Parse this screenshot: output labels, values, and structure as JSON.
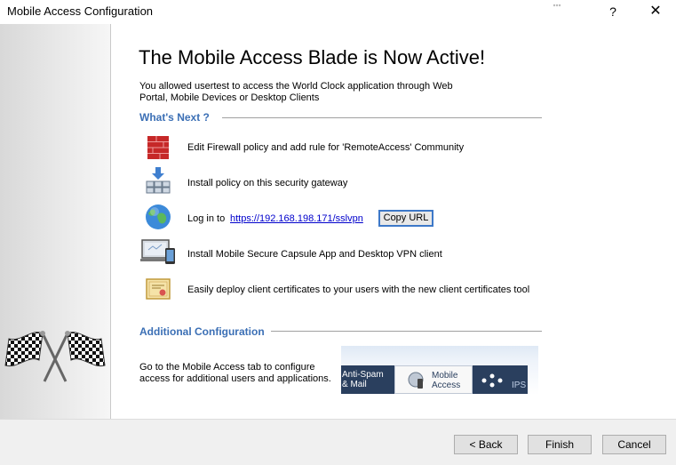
{
  "window": {
    "title": "Mobile Access Configuration",
    "help_label": "?",
    "close_label": "✕"
  },
  "main": {
    "heading": "The Mobile Access Blade is Now Active!",
    "intro": "You allowed usertest to access the World Clock application through Web Portal, Mobile Devices or Desktop Clients"
  },
  "whats_next": {
    "title": "What's Next ?",
    "items": [
      {
        "icon": "firewall-icon",
        "text": "Edit Firewall policy and add rule for 'RemoteAccess' Community"
      },
      {
        "icon": "install-policy-icon",
        "text": "Install policy on this security gateway"
      },
      {
        "icon": "globe-icon",
        "text": "Log in to",
        "link": "https://192.168.198.171/sslvpn",
        "button": "Copy URL"
      },
      {
        "icon": "devices-icon",
        "text": "Install Mobile Secure Capsule App and Desktop VPN client"
      },
      {
        "icon": "certificate-icon",
        "text": "Easily deploy client certificates to your users with the new client certificates tool"
      }
    ]
  },
  "additional": {
    "title": "Additional Configuration",
    "description": "Go to the Mobile Access tab to configure access for additional users and applications.",
    "tabs": {
      "left": "Anti-Spam & Mail",
      "middle": "Mobile Access",
      "right": "IPS"
    }
  },
  "footer": {
    "back": "< Back",
    "finish": "Finish",
    "cancel": "Cancel"
  },
  "colors": {
    "section_title": "#3b6fb5",
    "link": "#0000cc",
    "tab_dark": "#2a3f5e"
  }
}
